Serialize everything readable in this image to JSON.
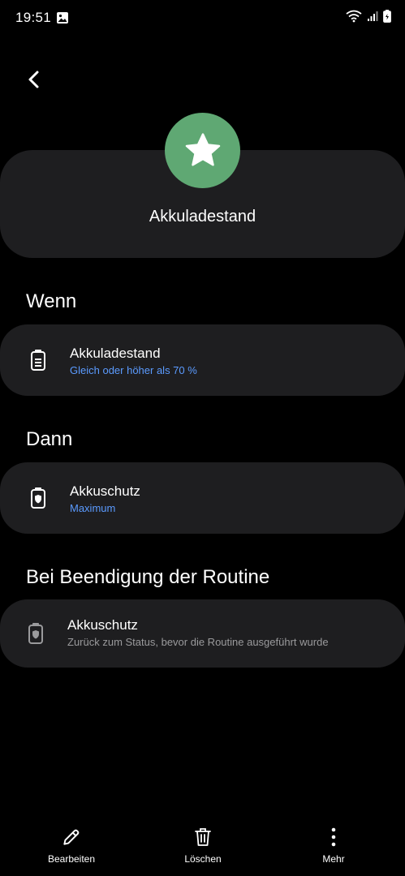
{
  "status_bar": {
    "time": "19:51",
    "icons": [
      "gallery-icon",
      "wifi-icon",
      "signal-icon",
      "battery-icon"
    ]
  },
  "header": {
    "title": "Akkuladestand",
    "icon": "star-icon",
    "icon_color": "#5fa873"
  },
  "sections": {
    "wenn": {
      "title": "Wenn",
      "item": {
        "title": "Akkuladestand",
        "subtitle": "Gleich oder höher als 70 %"
      }
    },
    "dann": {
      "title": "Dann",
      "item": {
        "title": "Akkuschutz",
        "subtitle": "Maximum"
      }
    },
    "ende": {
      "title": "Bei Beendigung der Routine",
      "item": {
        "title": "Akkuschutz",
        "subtitle": "Zurück zum Status, bevor die Routine ausgeführt wurde"
      }
    }
  },
  "bottom_bar": {
    "edit_label": "Bearbeiten",
    "delete_label": "Löschen",
    "more_label": "Mehr"
  },
  "colors": {
    "background": "#000000",
    "card": "#1e1e20",
    "accent_blue": "#5b9bff",
    "subtitle_gray": "#9a9a9c"
  }
}
